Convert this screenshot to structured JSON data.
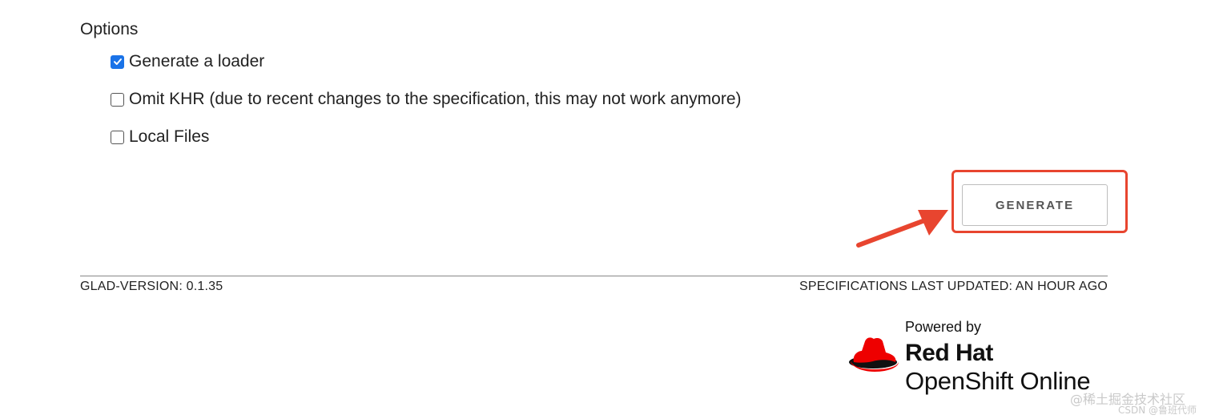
{
  "options": {
    "heading": "Options",
    "items": [
      {
        "label": "Generate a loader",
        "checked": true
      },
      {
        "label": "Omit KHR (due to recent changes to the specification, this may not work anymore)",
        "checked": false
      },
      {
        "label": "Local Files",
        "checked": false
      }
    ]
  },
  "actions": {
    "generate_label": "GENERATE"
  },
  "annotation": {
    "highlight_color": "#e8452f"
  },
  "footer": {
    "version": "GLAD-VERSION: 0.1.35",
    "specs_updated": "SPECIFICATIONS LAST UPDATED: AN HOUR AGO"
  },
  "branding": {
    "powered_by": "Powered by",
    "brand": "Red Hat",
    "product": "OpenShift Online",
    "logo_icon": "red-hat-fedora-icon",
    "logo_color": "#ee0000"
  },
  "watermark": {
    "line1": "@稀土掘金技术社区",
    "line2": "CSDN @鲁班代师"
  }
}
